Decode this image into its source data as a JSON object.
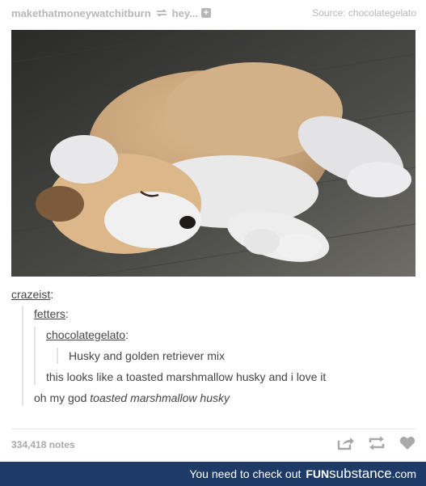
{
  "header": {
    "reblog_user": "makethatmoneywatchitburn",
    "reblog_from": "hey...",
    "source_label": "Source: chocolategelato"
  },
  "thread": {
    "level1_user": "crazeist",
    "level2_user": "fetters",
    "level3_user": "chocolategelato",
    "level4_text": "Husky and golden retriever mix",
    "level3_reply": "this looks like a toasted marshmallow husky and i love it",
    "level2_reply_plain": "oh my god ",
    "level2_reply_italic": "toasted marshmallow husky"
  },
  "footer": {
    "notes": "334,418 notes"
  },
  "banner": {
    "text": "You need to check out",
    "brand_a": "FUN",
    "brand_b": "substance",
    "brand_c": ".com"
  },
  "icons": [
    "reblog-icon",
    "add-icon",
    "share-icon",
    "reblog-post-icon",
    "heart-icon"
  ]
}
